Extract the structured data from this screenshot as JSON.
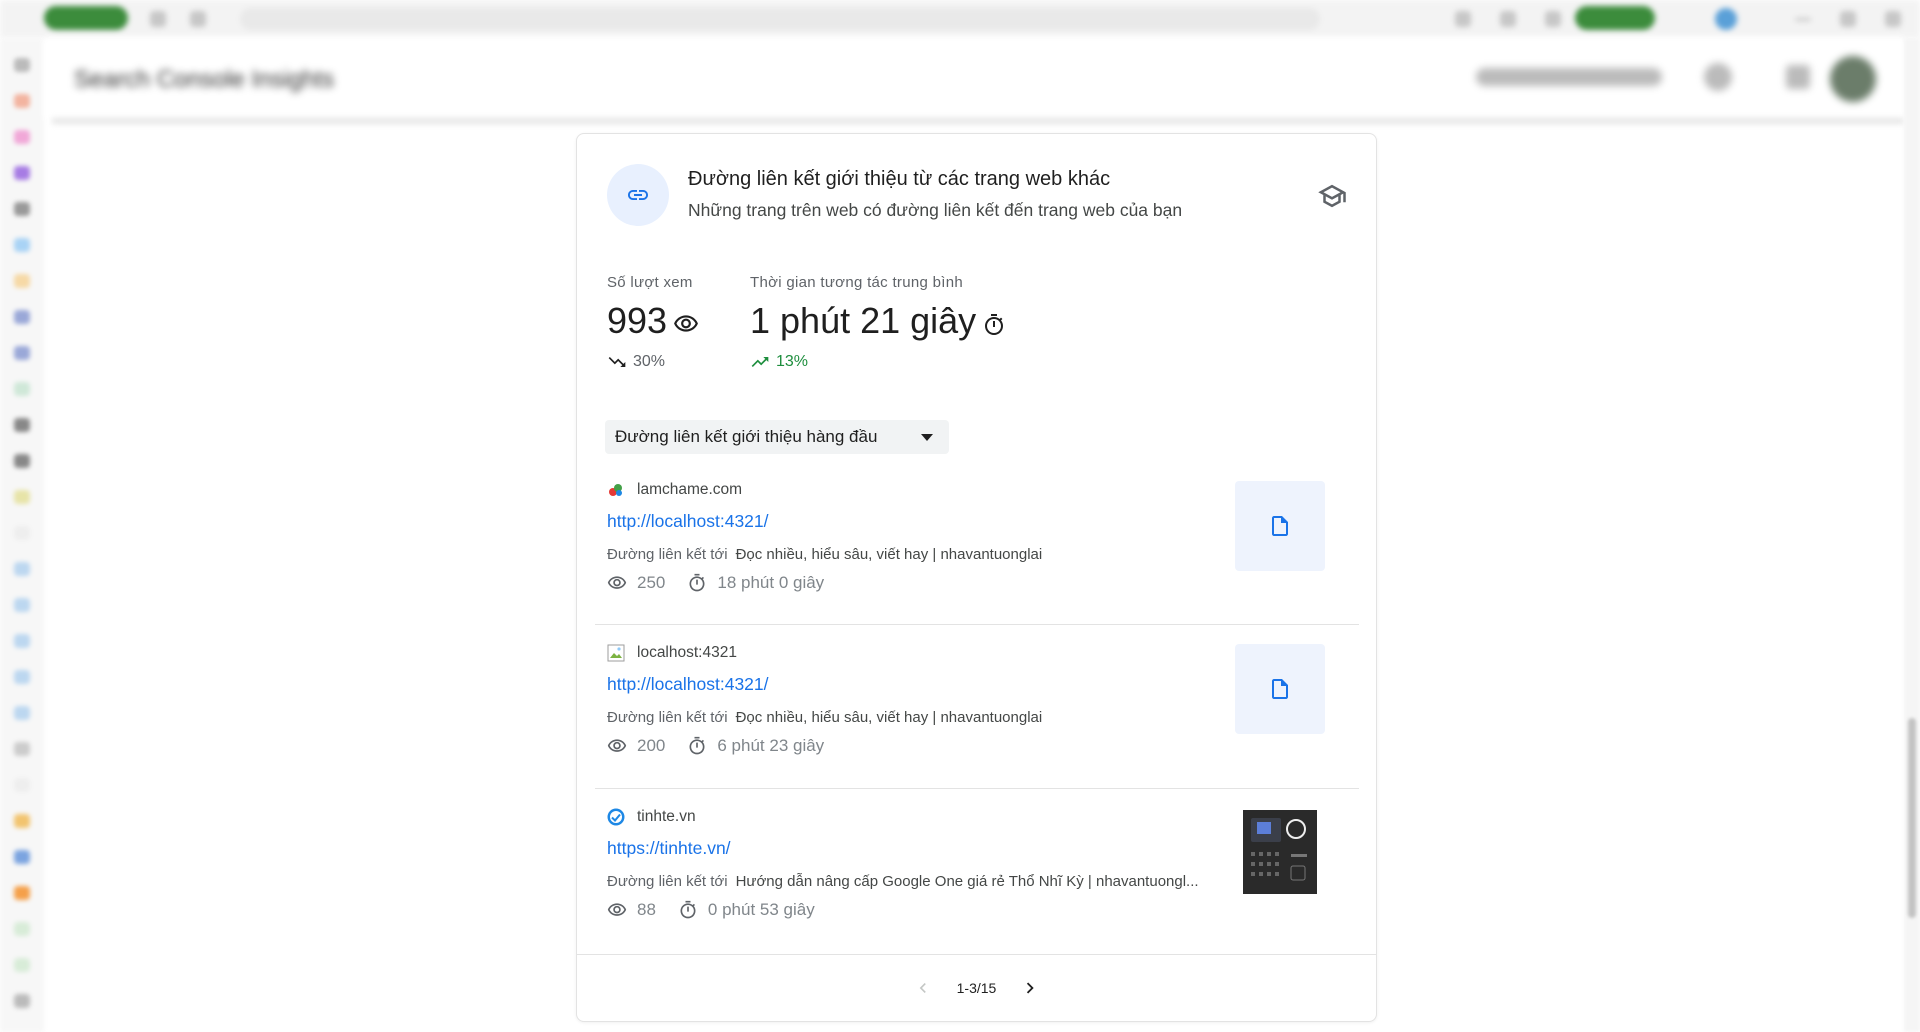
{
  "browser": {
    "tab_label": "Inbox",
    "profile_label": "Chat"
  },
  "app": {
    "title": "Search Console Insights",
    "feedback_label": "Chia sẻ ý kiến phản hồi"
  },
  "card": {
    "title": "Đường liên kết giới thiệu từ các trang web khác",
    "subtitle": "Những trang trên web có đường liên kết đến trang web của bạn",
    "icons": {
      "header": "link-icon",
      "learn": "graduation-cap-icon"
    }
  },
  "stats": [
    {
      "label": "Số lượt xem",
      "value": "993",
      "icon": "eye-icon",
      "change": "30%",
      "trend": "down",
      "color": "#5f6368"
    },
    {
      "label": "Thời gian tương tác trung bình",
      "value": "1 phút 21 giây",
      "icon": "timer-icon",
      "change": "13%",
      "trend": "up",
      "color": "#1e8e3e"
    }
  ],
  "dropdown": {
    "selected": "Đường liên kết giới thiệu hàng đầu"
  },
  "referrals": [
    {
      "domain": "lamchame.com",
      "url": "http://localhost:4321/",
      "to_label": "Đường liên kết tới",
      "target": "Đọc nhiều, hiểu sâu, viết hay | nhavantuonglai",
      "views": "250",
      "time": "18 phút 0 giây",
      "thumb": "document-icon"
    },
    {
      "domain": "localhost:4321",
      "url": "http://localhost:4321/",
      "to_label": "Đường liên kết tới",
      "target": "Đọc nhiều, hiểu sâu, viết hay | nhavantuonglai",
      "views": "200",
      "time": "6 phút 23 giây",
      "thumb": "document-icon"
    },
    {
      "domain": "tinhte.vn",
      "url": "https://tinhte.vn/",
      "to_label": "Đường liên kết tới",
      "target": "Hướng dẫn nâng cấp Google One giá rẻ Thổ Nhĩ Kỳ | nhavantuongl...",
      "views": "88",
      "time": "0 phút 53 giây",
      "thumb": "device-photo"
    }
  ],
  "pagination": {
    "label": "1-3/15"
  }
}
